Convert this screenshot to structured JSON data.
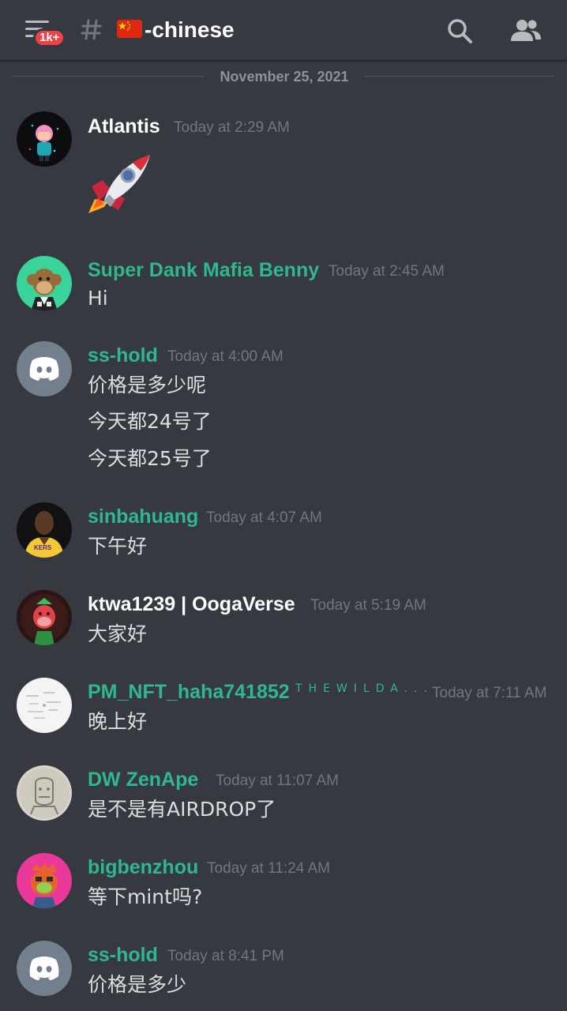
{
  "header": {
    "badge": "1k+",
    "channel_name": "-chinese",
    "icons": [
      "menu-icon",
      "hash-icon",
      "china-flag-icon",
      "search-icon",
      "members-icon"
    ]
  },
  "divider": {
    "date": "November 25, 2021"
  },
  "colors": {
    "background": "#36393f",
    "role_teal": "#2fb88f",
    "timestamp": "#72767d",
    "badge": "#ed4245"
  },
  "messages": [
    {
      "username": "Atlantis",
      "timestamp": "Today at 2:29 AM",
      "lines": [],
      "emoji": "rocket"
    },
    {
      "username": "Super Dank Mafia Benny",
      "timestamp": "Today at 2:45 AM",
      "lines": [
        "Hi"
      ]
    },
    {
      "username": "ss-hold",
      "timestamp": "Today at 4:00 AM",
      "lines": [
        "价格是多少呢",
        "今天都24号了",
        "今天都25号了"
      ]
    },
    {
      "username": "sinbahuang",
      "timestamp": "Today at 4:07 AM",
      "lines": [
        "下午好"
      ]
    },
    {
      "username": "ktwa1239 | OogaVerse",
      "timestamp": "Today at 5:19 AM",
      "lines": [
        "大家好"
      ]
    },
    {
      "username": "PM_NFT_haha741852",
      "user_tag": "THEWILDA...",
      "timestamp": "Today at 7:11 AM",
      "lines": [
        "晚上好"
      ]
    },
    {
      "username": "DW ZenApe",
      "timestamp": "Today at 11:07 AM",
      "lines": [
        "是不是有AIRDROP了"
      ]
    },
    {
      "username": "bigbenzhou",
      "timestamp": "Today at 11:24 AM",
      "lines": [
        "等下mint吗?"
      ]
    },
    {
      "username": "ss-hold",
      "timestamp": "Today at 8:41 PM",
      "lines": [
        "价格是多少"
      ]
    }
  ]
}
